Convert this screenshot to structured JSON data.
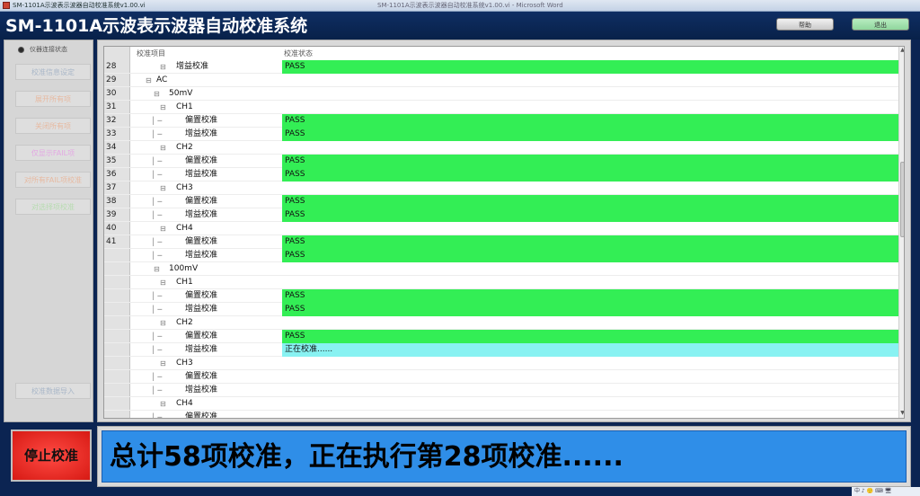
{
  "window": {
    "title": "SM-1101A示波表示波器自动校准系统v1.00.vi",
    "title_secondary": "SM-1101A示波表示波器自动校准系统v1.00.vi - Microsoft Word"
  },
  "app": {
    "title": "SM-1101A示波表示波器自动校准系统",
    "btn_help": "帮助",
    "btn_exit": "退出"
  },
  "sidebar": {
    "status_label": "仪器连接状态",
    "buttons": [
      {
        "label": "校准信息设定",
        "color": "#a9b7c8"
      },
      {
        "label": "展开所有项",
        "color": "#e7b9a0"
      },
      {
        "label": "关闭所有项",
        "color": "#e7b9a0"
      },
      {
        "label": "仅显示FAIL项",
        "color": "#e3a8e3"
      },
      {
        "label": "对所有FAIL项校准",
        "color": "#e7b9a0"
      },
      {
        "label": "对选择项校准",
        "color": "#b7dcb0"
      }
    ],
    "import_button": "校准数据导入",
    "stop_button": "停止校准"
  },
  "table": {
    "header": {
      "col_item": "校准项目",
      "col_status": "校准状态"
    },
    "rows": [
      {
        "num": "28",
        "label": "增益校准",
        "level": 3,
        "status": "PASS",
        "state": "pass"
      },
      {
        "num": "29",
        "label": "AC",
        "level": 1,
        "status": "",
        "state": ""
      },
      {
        "num": "30",
        "label": "50mV",
        "level": 2,
        "status": "",
        "state": ""
      },
      {
        "num": "31",
        "label": "CH1",
        "level": 3,
        "status": "",
        "state": ""
      },
      {
        "num": "32",
        "label": "偏置校准",
        "level": 4,
        "status": "PASS",
        "state": "pass"
      },
      {
        "num": "33",
        "label": "增益校准",
        "level": 4,
        "status": "PASS",
        "state": "pass"
      },
      {
        "num": "34",
        "label": "CH2",
        "level": 3,
        "status": "",
        "state": ""
      },
      {
        "num": "35",
        "label": "偏置校准",
        "level": 4,
        "status": "PASS",
        "state": "pass"
      },
      {
        "num": "36",
        "label": "增益校准",
        "level": 4,
        "status": "PASS",
        "state": "pass"
      },
      {
        "num": "37",
        "label": "CH3",
        "level": 3,
        "status": "",
        "state": ""
      },
      {
        "num": "38",
        "label": "偏置校准",
        "level": 4,
        "status": "PASS",
        "state": "pass"
      },
      {
        "num": "39",
        "label": "增益校准",
        "level": 4,
        "status": "PASS",
        "state": "pass"
      },
      {
        "num": "40",
        "label": "CH4",
        "level": 3,
        "status": "",
        "state": ""
      },
      {
        "num": "41",
        "label": "偏置校准",
        "level": 4,
        "status": "PASS",
        "state": "pass"
      },
      {
        "num": "",
        "label": "增益校准",
        "level": 4,
        "status": "PASS",
        "state": "pass"
      },
      {
        "num": "",
        "label": "100mV",
        "level": 2,
        "status": "",
        "state": ""
      },
      {
        "num": "",
        "label": "CH1",
        "level": 3,
        "status": "",
        "state": ""
      },
      {
        "num": "",
        "label": "偏置校准",
        "level": 4,
        "status": "PASS",
        "state": "pass"
      },
      {
        "num": "",
        "label": "增益校准",
        "level": 4,
        "status": "PASS",
        "state": "pass"
      },
      {
        "num": "",
        "label": "CH2",
        "level": 3,
        "status": "",
        "state": ""
      },
      {
        "num": "",
        "label": "偏置校准",
        "level": 4,
        "status": "PASS",
        "state": "pass"
      },
      {
        "num": "",
        "label": "增益校准",
        "level": 4,
        "status": "正在校准......",
        "state": "running"
      },
      {
        "num": "",
        "label": "CH3",
        "level": 3,
        "status": "",
        "state": ""
      },
      {
        "num": "",
        "label": "偏置校准",
        "level": 4,
        "status": "",
        "state": ""
      },
      {
        "num": "",
        "label": "增益校准",
        "level": 4,
        "status": "",
        "state": ""
      },
      {
        "num": "",
        "label": "CH4",
        "level": 3,
        "status": "",
        "state": ""
      },
      {
        "num": "",
        "label": "偏置校准",
        "level": 4,
        "status": "",
        "state": ""
      }
    ]
  },
  "message": "总计58项校准，正在执行第28项校准......",
  "tray": "中 ♪ 🙂 ⌨ 🖥",
  "colors": {
    "pass": "#33ee55",
    "running": "#88f2f2",
    "message_bg": "#2f8ee8",
    "stop": "#e8231c"
  }
}
